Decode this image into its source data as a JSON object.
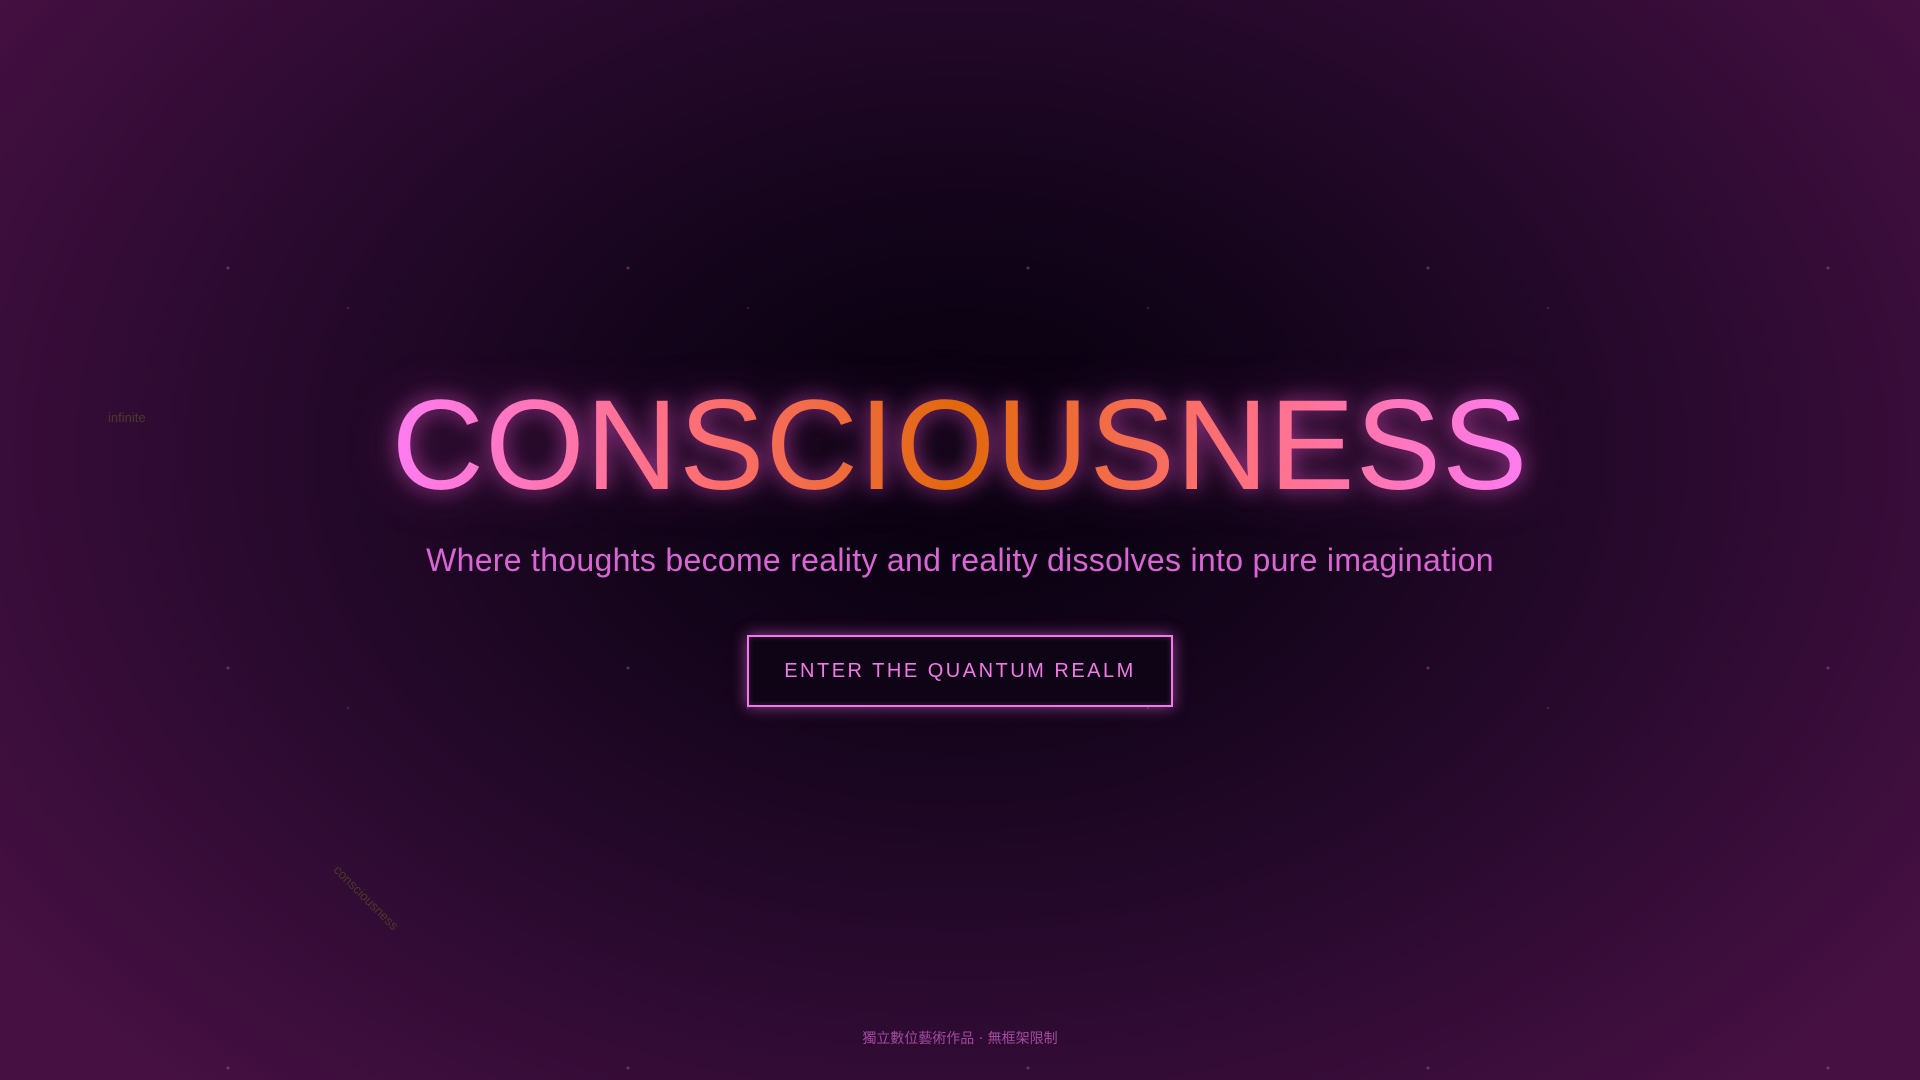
{
  "background": {
    "center_color": "#05000d",
    "edge_color": "#471043"
  },
  "floating_words": {
    "left_word": "infinite",
    "diagonal_word": "consciousness"
  },
  "hero": {
    "title": "CONSCIOUSNESS",
    "subtitle": "Where thoughts become reality and reality dissolves into pure imagination",
    "cta_label": "ENTER THE QUANTUM REALM"
  },
  "footer": {
    "text": "獨立數位藝術作品 · 無框架限制"
  },
  "colors": {
    "title_gradient": [
      "#ff7cf2",
      "#ff6f7a",
      "#e2680b"
    ],
    "subtitle": "#d866d3",
    "button_border": "#f07ae6",
    "footer": "#a34a9e"
  }
}
